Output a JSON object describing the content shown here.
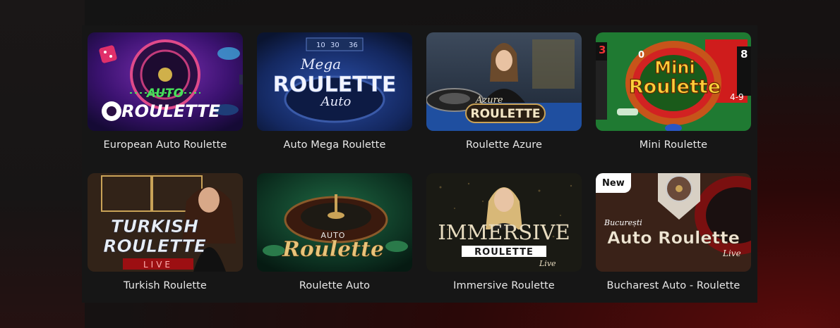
{
  "games": [
    {
      "title": "European Auto Roulette",
      "logo": [
        "AUTO",
        "ROULETTE"
      ]
    },
    {
      "title": "Auto Mega Roulette",
      "logo": [
        "Mega",
        "ROULETTE",
        "Auto"
      ],
      "numbers": [
        "10",
        "30",
        "36"
      ]
    },
    {
      "title": "Roulette Azure",
      "logo": [
        "Azure",
        "ROULETTE"
      ]
    },
    {
      "title": "Mini Roulette",
      "logo": [
        "Mini",
        "Roulette"
      ],
      "numbers": [
        "3",
        "0",
        "8",
        "4-9"
      ]
    },
    {
      "title": "Turkish Roulette",
      "logo": [
        "TURKISH",
        "ROULETTE",
        "LIVE"
      ]
    },
    {
      "title": "Roulette Auto",
      "logo": [
        "AUTO",
        "Roulette"
      ]
    },
    {
      "title": "Immersive Roulette",
      "logo": [
        "IMMERSIVE",
        "ROULETTE",
        "Live"
      ]
    },
    {
      "title": "Bucharest Auto - Roulette",
      "logo": [
        "București",
        "Auto Roulette",
        "Live"
      ],
      "badge": "New"
    }
  ],
  "colors": {
    "panel": "#161616",
    "title_text": "#e8e8e8",
    "badge_bg": "#ffffff"
  }
}
